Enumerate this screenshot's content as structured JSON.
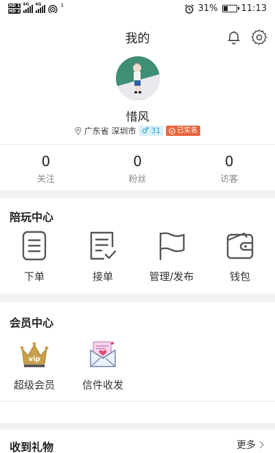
{
  "status_bar": {
    "hd1": "HD 1",
    "hd2": "HD 2",
    "net1": "4G",
    "net2": "4G",
    "wifi_num": "3",
    "battery": "31%",
    "time": "11:13"
  },
  "header": {
    "title": "我的",
    "icons": [
      "bell-icon",
      "gear-icon"
    ]
  },
  "profile": {
    "name": "惜风",
    "location": "广东省 深圳市",
    "gender_symbol": "♂",
    "age": "31",
    "verified": "已实名"
  },
  "stats": [
    {
      "value": "0",
      "label": "关注"
    },
    {
      "value": "0",
      "label": "粉丝"
    },
    {
      "value": "0",
      "label": "访客"
    }
  ],
  "play_center": {
    "title": "陪玩中心",
    "items": [
      {
        "label": "下单",
        "icon": "order-icon"
      },
      {
        "label": "接单",
        "icon": "accept-order-icon"
      },
      {
        "label": "管理/发布",
        "icon": "flag-icon"
      },
      {
        "label": "钱包",
        "icon": "wallet-icon"
      }
    ]
  },
  "member_center": {
    "title": "会员中心",
    "items": [
      {
        "label": "超级会员",
        "icon": "vip-crown-icon",
        "badge": "vip"
      },
      {
        "label": "信件收发",
        "icon": "letter-icon"
      }
    ]
  },
  "gifts": {
    "title": "收到礼物",
    "more": "更多"
  },
  "colors": {
    "accent_orange": "#e8663b",
    "gender_blue": "#1e9bd2",
    "vip_gold": "#c9a04a"
  }
}
